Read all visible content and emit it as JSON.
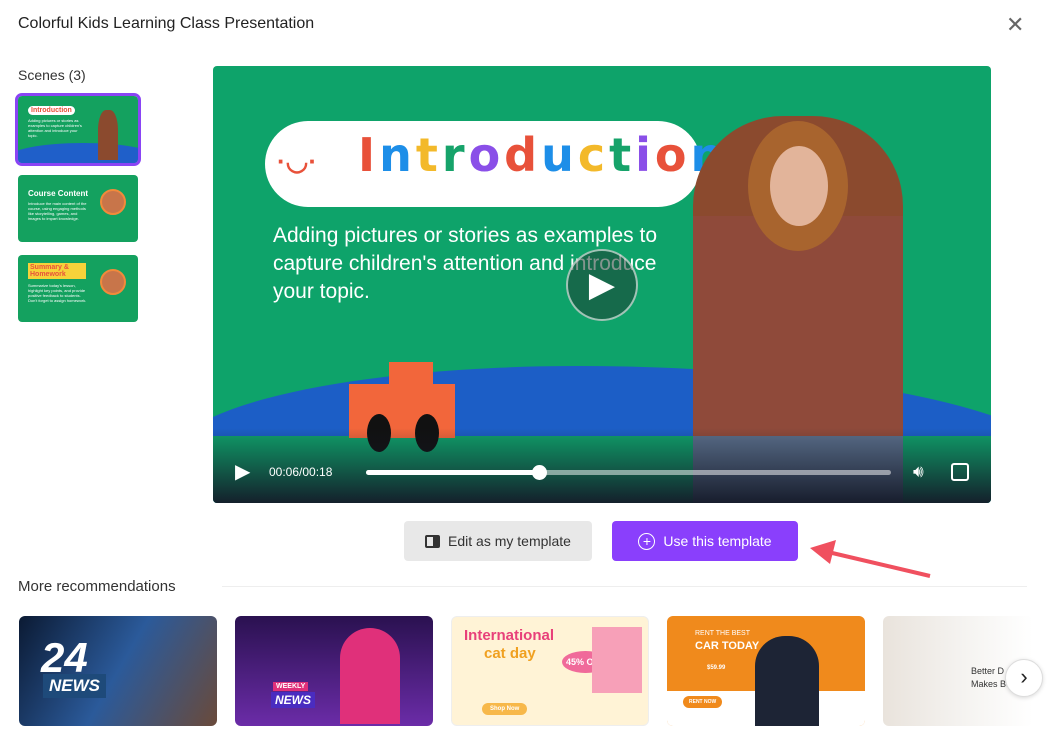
{
  "dialog": {
    "title": "Colorful Kids Learning Class Presentation",
    "close_icon": "close-icon"
  },
  "scenes": {
    "label": "Scenes (3)",
    "items": [
      {
        "title": "Introduction",
        "text": "Adding pictures or stories as examples to capture children's attention and introduce your topic.",
        "selected": true
      },
      {
        "title": "Course Content",
        "text": "Introduce the main content of the course, using engaging methods like storytelling, games, and images to impart knowledge.",
        "selected": false
      },
      {
        "title": "Summary & Homework",
        "text": "Summarize today's lesson, highlight key points, and provide positive feedback to students. Don't forget to assign homework.",
        "selected": false
      }
    ]
  },
  "video": {
    "heading": "Introduction",
    "subtitle": "Adding pictures or stories as examples to capture children's attention and introduce your topic.",
    "time": "00:06/00:18",
    "progress": 0.33
  },
  "actions": {
    "edit_label": "Edit as my template",
    "use_label": "Use this template",
    "accent": "#8a3ffc"
  },
  "recommendations": {
    "label": "More recommendations",
    "items": [
      {
        "line1": "24",
        "line2": "NEWS"
      },
      {
        "line1": "WEEKLY",
        "line2": "NEWS"
      },
      {
        "line1": "International",
        "line2": "cat day",
        "badge": "45% OFF",
        "button": "Shop Now"
      },
      {
        "line1": "RENT THE BEST",
        "line2": "CAR TODAY",
        "price": "$59.99",
        "button": "RENT NOW"
      },
      {
        "line1": "Better D",
        "line2": "Makes Be"
      }
    ]
  }
}
